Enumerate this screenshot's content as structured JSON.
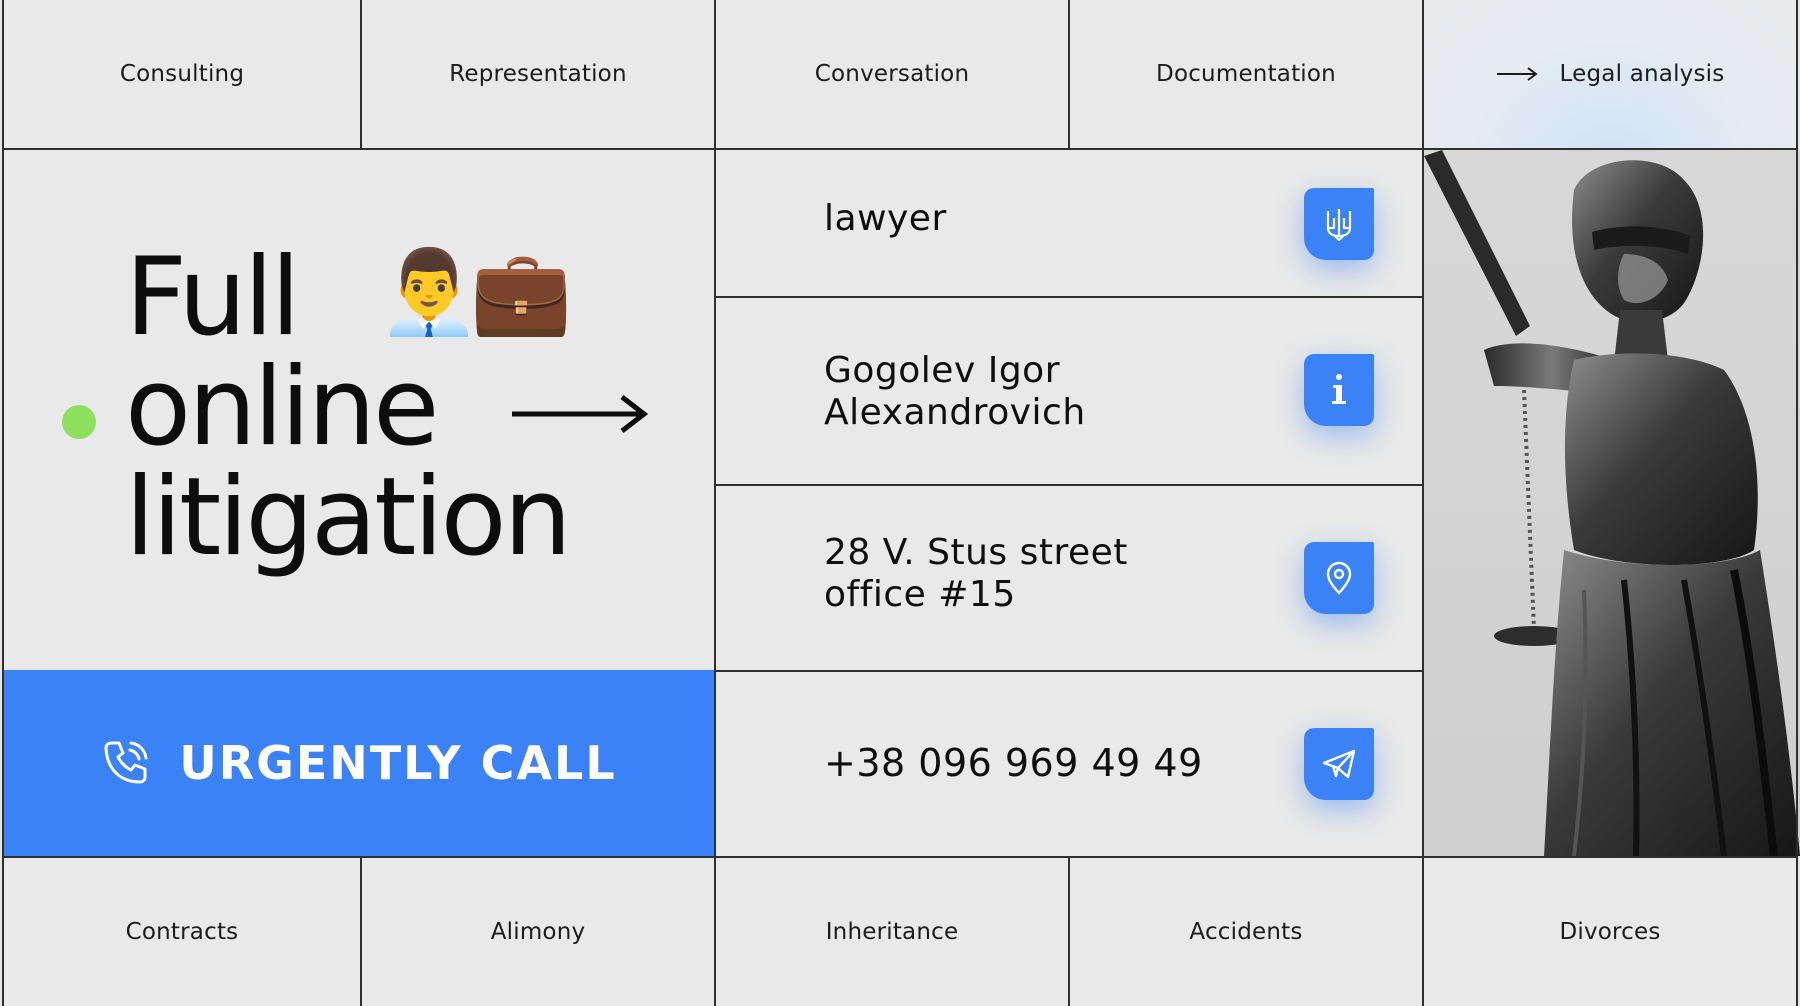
{
  "top_nav": [
    {
      "label": "Consulting"
    },
    {
      "label": "Representation"
    },
    {
      "label": "Conversation"
    },
    {
      "label": "Documentation"
    },
    {
      "label": "Legal analysis",
      "active": true
    }
  ],
  "hero": {
    "line1": "Full",
    "line2": "online",
    "line3": "litigation",
    "emoji_person": "👨‍💼",
    "emoji_briefcase": "💼"
  },
  "cta": {
    "label": "URGENTLY CALL",
    "icon": "phone-icon"
  },
  "info": [
    {
      "line1": "lawyer",
      "line2": "",
      "icon": "trident-icon"
    },
    {
      "line1": "Gogolev Igor",
      "line2": "Alexandrovich",
      "icon": "info-icon"
    },
    {
      "line1": "28 V. Stus street",
      "line2": "office #15",
      "icon": "location-pin-icon"
    },
    {
      "line1": "+38 096 969 49 49",
      "line2": "",
      "icon": "send-icon"
    }
  ],
  "bottom_nav": [
    {
      "label": "Contracts"
    },
    {
      "label": "Alimony"
    },
    {
      "label": "Inheritance"
    },
    {
      "label": "Accidents"
    },
    {
      "label": "Divorces"
    }
  ],
  "colors": {
    "accent": "#3b82f6",
    "dot": "#8ee05f",
    "background": "#e9e9e9",
    "grid_line": "#2f2f2f",
    "text": "#0d0d0d"
  }
}
